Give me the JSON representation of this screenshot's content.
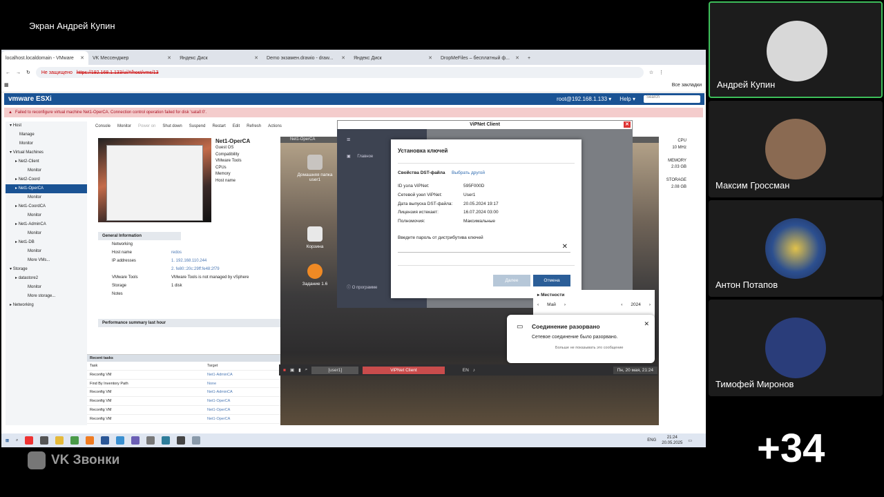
{
  "call": {
    "title": "Экран Андрей Купин",
    "brand": "VK Звонки",
    "more_count": "+34"
  },
  "participants": [
    {
      "name": "Андрей Купин"
    },
    {
      "name": "Максим Гроссман"
    },
    {
      "name": "Антон Потапов"
    },
    {
      "name": "Тимофей Миронов"
    }
  ],
  "browser": {
    "tabs": [
      "localhost.localdomain - VMware",
      "VK Мессенджер",
      "Яндекс Диск",
      "Demo экзамен.drawio - draw...",
      "Яндекс Диск",
      "DropMeFiles – бесплатный ф..."
    ],
    "not_secure": "Не защищено",
    "url": "https://192.168.1.133/ui/#/host/vms/13",
    "bookmarks": "Все закладки"
  },
  "esxi": {
    "logo": "vmware ESXi",
    "user": "root@192.168.1.133 ▾",
    "help": "Help ▾",
    "search": "Search",
    "error": "Failed to reconfigure virtual machine Net1-OperCA. Connection control operation failed for disk 'sata0:0'.",
    "tree": [
      "Host",
      "Manage",
      "Monitor",
      "Virtual Machines",
      "Net2-Client",
      "Monitor",
      "Net2-Coord",
      "Net1-OperCA",
      "Monitor",
      "Net1-CoordCA",
      "Monitor",
      "Net1-AdminCA",
      "Monitor",
      "Net1-DB",
      "Monitor",
      "More VMs...",
      "Storage",
      "datastore2",
      "Monitor",
      "More storage...",
      "Networking"
    ],
    "toolbar": [
      "Console",
      "Monitor",
      "Power on",
      "Shut down",
      "Suspend",
      "Restart",
      "Edit",
      "Refresh",
      "Actions"
    ],
    "vm_name": "Net1-OperCA",
    "vm_fields": [
      "Guest OS",
      "Compatibility",
      "VMware Tools",
      "CPUs",
      "Memory",
      "Host name"
    ],
    "general": "General Information",
    "gen_rows": [
      {
        "k": "Networking",
        "v": ""
      },
      {
        "k": "Host name",
        "v": "redos"
      },
      {
        "k": "IP addresses",
        "v": "1. 192.168.110.244"
      },
      {
        "k": "",
        "v": "2. fe80::20c:29ff:fe48:2f79"
      },
      {
        "k": "VMware Tools",
        "v": "VMware Tools is not managed by vSphere"
      },
      {
        "k": "Storage",
        "v": "1 disk"
      },
      {
        "k": "Notes",
        "v": ""
      }
    ],
    "perf": "Performance summary last hour",
    "resources": [
      "CPU",
      "10 MHz",
      "MEMORY",
      "2.03 GB",
      "STORAGE",
      "2.08 GB"
    ],
    "tasks_title": "Recent tasks",
    "tasks_cols": [
      "Task",
      "Target"
    ],
    "tasks": [
      {
        "task": "Reconfig VM",
        "target": "Net1-AdminCA"
      },
      {
        "task": "Find By Inventory Path",
        "target": "None"
      },
      {
        "task": "Reconfig VM",
        "target": "Net1-AdminCA"
      },
      {
        "task": "Reconfig VM",
        "target": "Net1-OperCA"
      },
      {
        "task": "Reconfig VM",
        "target": "Net1-OperCA"
      },
      {
        "task": "Reconfig VM",
        "target": "Net1-OperCA"
      }
    ]
  },
  "console": {
    "title": "Net1-OperCA",
    "icons": [
      "Домашняя папка user1",
      "Корзина",
      "Задание 1.6"
    ]
  },
  "vipnet": {
    "title": "ViPNet Client",
    "side_main": "Главное",
    "side_about": "О программе",
    "dialog_title": "Установка ключей",
    "props_label": "Свойства DST-файла",
    "choose_other": "Выбрать другой",
    "rows": [
      {
        "k": "ID узла ViPNet:",
        "v": "595F000D"
      },
      {
        "k": "Сетевой узел ViPNet:",
        "v": "User1"
      },
      {
        "k": "Дата выпуска DST-файла:",
        "v": "20.05.2024 19:17"
      },
      {
        "k": "Лицензия истекает:",
        "v": "16.07.2024 03:00"
      },
      {
        "k": "Полномочия:",
        "v": "Максимальные"
      }
    ],
    "prompt": "Введите пароль от дистрибутива ключей",
    "next": "Далее",
    "cancel": "Отмена"
  },
  "calendar": {
    "title": "Местности",
    "month": "Май",
    "year": "2024"
  },
  "notification": {
    "title": "Соединение разорвано",
    "message": "Сетевое соединение было разорвано.",
    "dont_show": "Больше не показывать это сообщение"
  },
  "panel": {
    "task": "[user1]",
    "app": "ViPNet Client",
    "lang": "EN",
    "clock": "Пн, 20 мая, 21:24"
  },
  "windows": {
    "lang": "ENG",
    "time": "21:24",
    "date": "20.05.2025"
  }
}
